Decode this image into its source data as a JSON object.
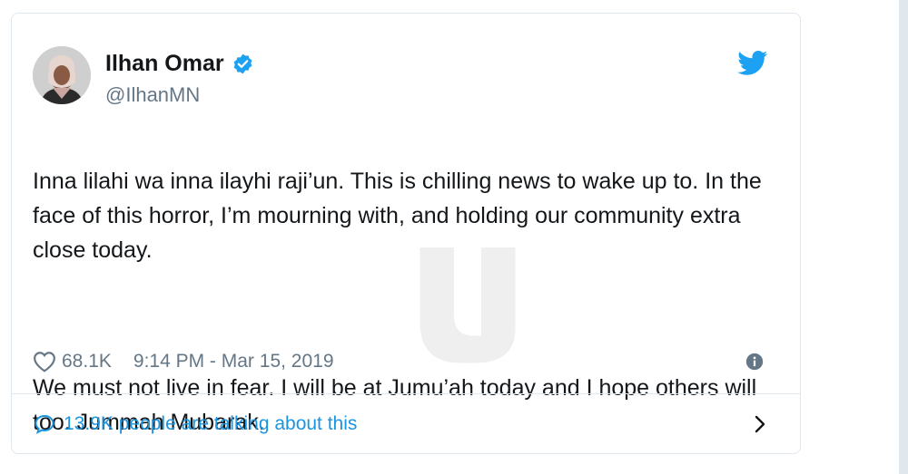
{
  "tweet": {
    "author_name": "Ilhan Omar",
    "handle": "@IlhanMN",
    "paragraph_1": "Inna lilahi wa inna ilayhi raji’un. This is chilling news to wake up to. In the face of this horror, I’m mourning with, and holding our community extra close today.",
    "paragraph_2": "We must not live in fear. I will be at Jumu’ah today and I hope others will too. Jummah Mubarak.",
    "likes": "68.1K",
    "timestamp": "9:14 PM - Mar 15, 2019",
    "conversation_text": "13.9K people are talking about this"
  },
  "icons": {
    "verified": "verified-badge-icon",
    "brand": "twitter-bird-icon",
    "like": "heart-icon",
    "info": "info-icon",
    "reply": "speech-bubble-icon",
    "chevron": "chevron-right-icon"
  },
  "colors": {
    "accent": "#1da1f2",
    "link": "#1b95e0",
    "muted": "#657786",
    "text": "#14171a",
    "border": "#e1e8ed"
  }
}
